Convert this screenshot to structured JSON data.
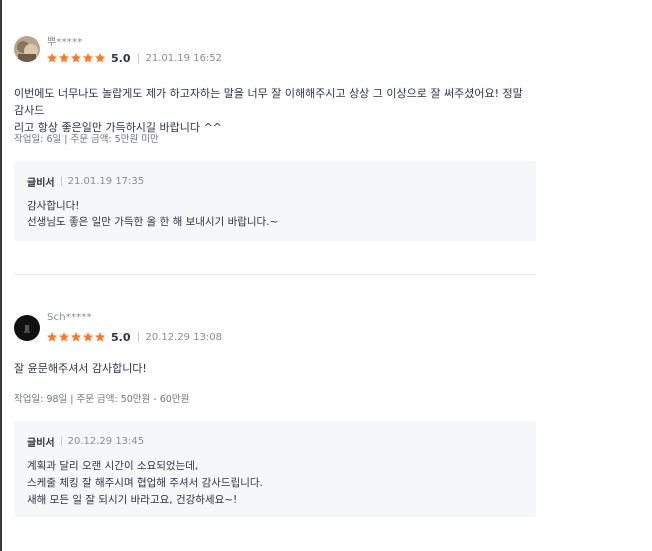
{
  "reviews": [
    {
      "username": "뿌*****",
      "score": "5.0",
      "date": "21.01.19 16:52",
      "stars": 5,
      "body": "이번에도 너무나도 놀랍게도 제가 하고자하는 말을 너무 잘 이해해주시고 상상 그 이상으로 잘 써주셨어요! 정말 감사드\n리고 항상 좋은일만 가득하시길 바랍니다 ^^",
      "meta": "작업일: 6일 | 주문 금액: 5만원 미만",
      "reply": {
        "author": "글비서",
        "date": "21.01.19 17:35",
        "text": "감사합니다!\n선생님도 좋은 일만 가득한 올 한 해 보내시기 바랍니다.~"
      }
    },
    {
      "username": "Sch*****",
      "score": "5.0",
      "date": "20.12.29 13:08",
      "stars": 5,
      "body": "잘 윤문해주셔서 감사합니다!",
      "meta": "작업일: 98일 | 주문 금액: 50만원 - 60만원",
      "reply": {
        "author": "글비서",
        "date": "20.12.29 13:45",
        "text": "계획과 달리 오랜 시간이 소요되었는데,\n스케줄 체킹 잘 해주시며 협업해 주셔서 감사드립니다.\n새해 모든 일 잘 되시기 바라고요, 건강하세요~!"
      }
    }
  ],
  "colors": {
    "star": "#ff7a28",
    "text": "#303441",
    "muted": "#8a8d94",
    "reply_bg": "#f6f7f9"
  },
  "icons": [
    "avatar-photo",
    "star-icon"
  ]
}
